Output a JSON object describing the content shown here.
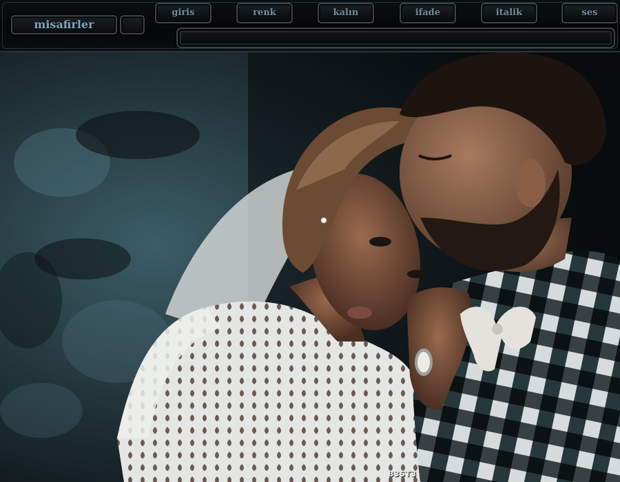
{
  "header": {
    "nick_label": "misafirler",
    "tabs": [
      {
        "label": "giris"
      },
      {
        "label": "renk"
      },
      {
        "label": "kalın"
      },
      {
        "label": "ifade"
      },
      {
        "label": "italik"
      },
      {
        "label": "ses"
      }
    ]
  },
  "photo": {
    "signature": "B3ST3"
  },
  "colors": {
    "frame": "#050708",
    "accent_text": "#7fa6bc",
    "background_wall": "#2f4c55"
  }
}
